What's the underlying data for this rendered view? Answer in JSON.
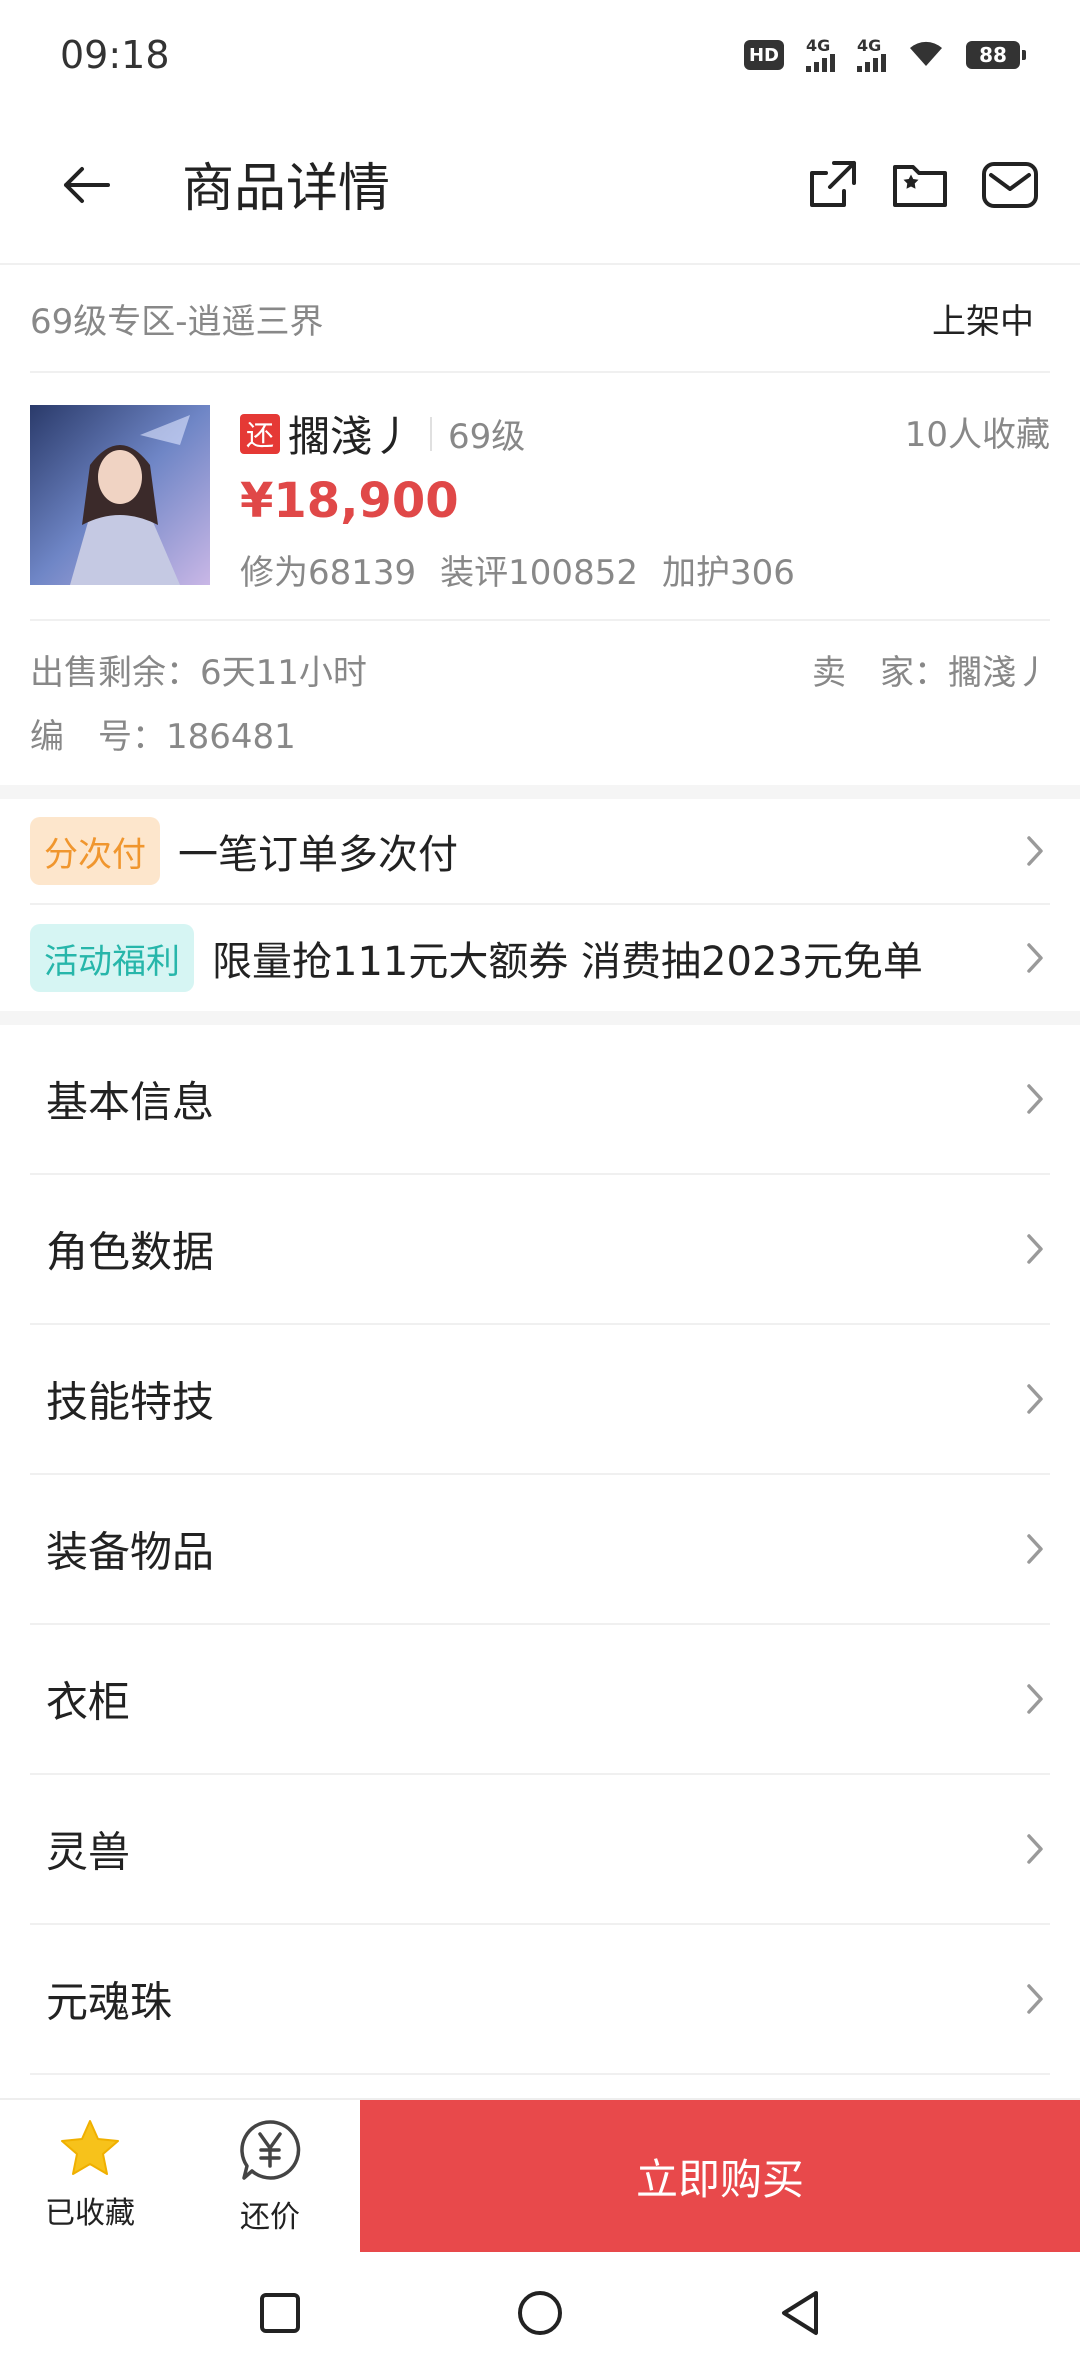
{
  "status_bar": {
    "time": "09:18",
    "hd_label": "HD",
    "signal1_label": "4G",
    "signal2_label": "4G",
    "battery": "88"
  },
  "header": {
    "title": "商品详情",
    "icons": [
      "share-icon",
      "favorite-folder-icon",
      "message-icon"
    ]
  },
  "product": {
    "breadcrumb": "69级专区-逍遥三界",
    "status": "上架中",
    "tag": "还",
    "name": "擱淺丿",
    "level": "69级",
    "favorites": "10人收藏",
    "price": "¥18,900",
    "stats": [
      "修为68139",
      "装评100852",
      "加护306"
    ],
    "time_left": "出售剩余：6天11小时",
    "seller": "卖　家：擱淺丿",
    "serial": "编　号：186481"
  },
  "promos": [
    {
      "tag": "分次付",
      "text": "一笔订单多次付",
      "tag_bg": "#fde6cc",
      "tag_color": "#f0962e"
    },
    {
      "tag": "活动福利",
      "text": "限量抢111元大额券 消费抽2023元免单",
      "tag_bg": "#d6f5f3",
      "tag_color": "#27b6aa"
    }
  ],
  "menu": [
    {
      "label": "基本信息"
    },
    {
      "label": "角色数据"
    },
    {
      "label": "技能特技"
    },
    {
      "label": "装备物品"
    },
    {
      "label": "衣柜"
    },
    {
      "label": "灵兽"
    },
    {
      "label": "元魂珠"
    }
  ],
  "bottom_bar": {
    "favorite_label": "已收藏",
    "bargain_label": "还价",
    "buy_label": "立即购买",
    "star_color": "#f7c21b"
  },
  "colors": {
    "accent": "#e8494b",
    "price": "#e04848"
  }
}
